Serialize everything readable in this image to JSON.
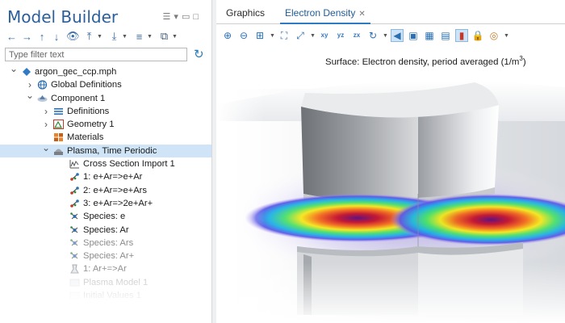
{
  "left_panel": {
    "title": "Model Builder",
    "filter_placeholder": "Type filter text",
    "tree": [
      {
        "label": "argon_gec_ccp.mph",
        "icon": "model-file-icon",
        "level": 0,
        "toggle": "expanded",
        "state": "normal"
      },
      {
        "label": "Global Definitions",
        "icon": "globe-icon",
        "level": 1,
        "toggle": "collapsed",
        "state": "normal"
      },
      {
        "label": "Component 1",
        "icon": "component-icon",
        "level": 1,
        "toggle": "expanded",
        "state": "normal"
      },
      {
        "label": "Definitions",
        "icon": "definitions-icon",
        "level": 2,
        "toggle": "collapsed",
        "state": "normal"
      },
      {
        "label": "Geometry 1",
        "icon": "geometry-icon",
        "level": 2,
        "toggle": "collapsed",
        "state": "normal"
      },
      {
        "label": "Materials",
        "icon": "materials-icon",
        "level": 2,
        "toggle": "none",
        "state": "normal"
      },
      {
        "label": "Plasma, Time Periodic",
        "icon": "plasma-icon",
        "level": 2,
        "toggle": "expanded",
        "state": "selected"
      },
      {
        "label": "Cross Section Import 1",
        "icon": "cross-section-icon",
        "level": 3,
        "toggle": "none",
        "state": "normal"
      },
      {
        "label": "1: e+Ar=>e+Ar",
        "icon": "reaction-icon",
        "level": 3,
        "toggle": "none",
        "state": "normal"
      },
      {
        "label": "2: e+Ar=>e+Ars",
        "icon": "reaction-icon",
        "level": 3,
        "toggle": "none",
        "state": "normal"
      },
      {
        "label": "3: e+Ar=>2e+Ar+",
        "icon": "reaction-icon",
        "level": 3,
        "toggle": "none",
        "state": "normal"
      },
      {
        "label": "Species: e",
        "icon": "species-icon",
        "level": 3,
        "toggle": "none",
        "state": "normal"
      },
      {
        "label": "Species: Ar",
        "icon": "species-icon",
        "level": 3,
        "toggle": "none",
        "state": "normal"
      },
      {
        "label": "Species: Ars",
        "icon": "species-icon",
        "level": 3,
        "toggle": "none",
        "state": "dim"
      },
      {
        "label": "Species: Ar+",
        "icon": "species-icon",
        "level": 3,
        "toggle": "none",
        "state": "dim"
      },
      {
        "label": "1: Ar+=>Ar",
        "icon": "surface-reaction-icon",
        "level": 3,
        "toggle": "none",
        "state": "dim"
      },
      {
        "label": "Plasma Model 1",
        "icon": "plasma-model-icon",
        "level": 3,
        "toggle": "none",
        "state": "dim2"
      },
      {
        "label": "Initial Values 1",
        "icon": "initial-values-icon",
        "level": 3,
        "toggle": "none",
        "state": "dim2"
      }
    ]
  },
  "right_panel": {
    "tabs": [
      {
        "label": "Graphics",
        "active": false
      },
      {
        "label": "Electron Density",
        "active": true,
        "closable": true
      }
    ],
    "plot_title_prefix": "Surface: Electron density, period averaged (1/m",
    "plot_title_sup": "3",
    "plot_title_suffix": ")"
  },
  "colors": {
    "title_blue": "#2a5f9c",
    "selected_row": "#cfe5f7",
    "active_tab_underline": "#2e7bc4",
    "toolbar_icon": "#2a6fb0"
  }
}
